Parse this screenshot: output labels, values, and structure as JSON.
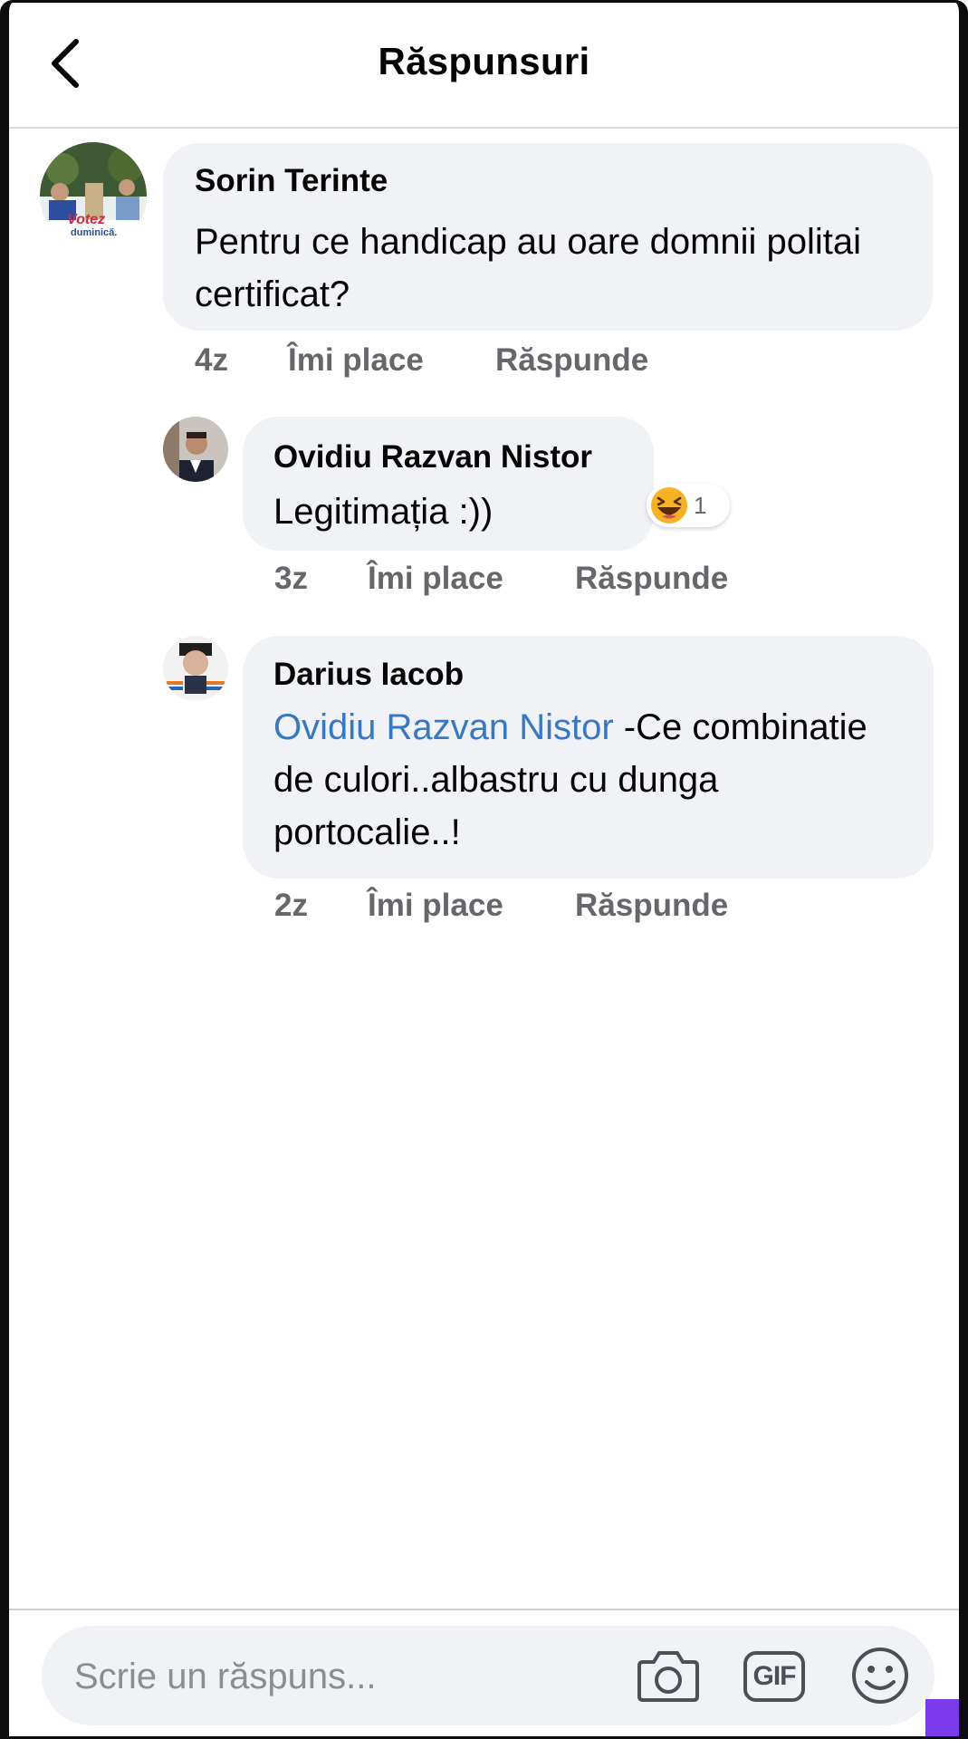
{
  "header": {
    "title": "Răspunsuri"
  },
  "comments": [
    {
      "author": "Sorin Terinte",
      "text": "Pentru ce handicap au oare domnii politai certificat?",
      "time": "4z",
      "like_label": "Îmi place",
      "reply_label": "Răspunde",
      "avatar_caption_1": "Votez",
      "avatar_caption_2": "duminică."
    },
    {
      "author": "Ovidiu Razvan Nistor",
      "text": "Legitimația :))",
      "time": "3z",
      "like_label": "Îmi place",
      "reply_label": "Răspunde",
      "reaction": {
        "icon": "haha-icon",
        "count": "1"
      }
    },
    {
      "author": "Darius Iacob",
      "mention": "Ovidiu Razvan Nistor",
      "text": " -Ce combinatie de culori..albastru cu dunga portocalie..!",
      "time": "2z",
      "like_label": "Îmi place",
      "reply_label": "Răspunde"
    }
  ],
  "composer": {
    "placeholder": "Scrie un răspuns...",
    "icons": [
      "camera-icon",
      "gif-icon",
      "emoji-icon"
    ],
    "gif_label": "GIF"
  },
  "colors": {
    "mention": "#3578c7",
    "bubble": "#f0f2f5",
    "meta": "#65676b"
  }
}
